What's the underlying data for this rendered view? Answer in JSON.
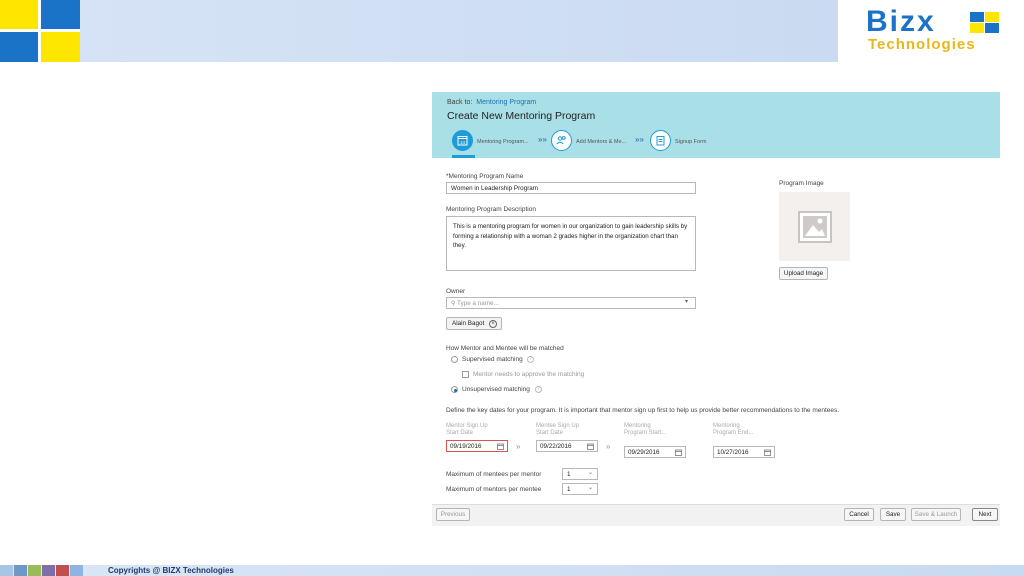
{
  "footer": {
    "copyright": "Copyrights @ BIZX Technologies"
  },
  "logo": {
    "line1": "Bizx",
    "line2": "Technologies"
  },
  "header": {
    "back_prefix": "Back to:",
    "back_link": "Mentoring Program",
    "title": "Create New Mentoring Program",
    "steps": [
      {
        "label": "Mentoring Program..."
      },
      {
        "label": "Add Mentors & Me..."
      },
      {
        "label": "Signup Form"
      }
    ],
    "step_icon_text": "14",
    "step_sep": "»»"
  },
  "form": {
    "name_label": "*Mentoring Program Name",
    "name_value": "Women in Leadership Program",
    "desc_label": "Mentoring Program Description",
    "desc_value": "This is a mentoring program for women in our organization to gain leadership skills by forming a relationship with a woman 2 grades higher in the organization chart than they.",
    "image_label": "Program Image",
    "upload_button": "Upload Image",
    "owner_label": "Owner",
    "owner_placeholder": "Type a name...",
    "owner_chip": "Alain Bagot",
    "match_label": "How Mentor and Mentee will be matched",
    "options": {
      "supervised": "Supervised matching",
      "approve": "Mentor needs to approve the matching",
      "unsupervised": "Unsupervised matching",
      "selected": "unsupervised"
    },
    "dates_intro": "Define the key dates for your program. It is important that mentor sign up first to help us provide better recommendations to the mentees.",
    "dates": [
      {
        "label1": "Mentor Sign Up",
        "label2": "Start Date",
        "value": "09/19/2016"
      },
      {
        "label1": "Mentee Sign Up",
        "label2": "Start Date",
        "value": "09/22/2016"
      },
      {
        "label1": "Mentoring",
        "label2": "Program Start...",
        "value": "09/29/2016"
      },
      {
        "label1": "Mentoring",
        "label2": "Program End...",
        "value": "10/27/2016"
      }
    ],
    "date_sep": "»",
    "max_mentees_label": "Maximum of mentees per mentor",
    "max_mentees_value": "1",
    "max_mentors_label": "Maximum of mentors per mentee",
    "max_mentors_value": "1"
  },
  "buttons": {
    "previous": "Previous",
    "cancel": "Cancel",
    "save": "Save",
    "save_launch": "Save & Launch",
    "next": "Next"
  },
  "colors": {
    "header_bg": "#a9dfe6",
    "accent": "#1e9bd8",
    "error": "#d9534f",
    "brand_blue": "#1b73c8",
    "brand_yellow": "#ffe600"
  }
}
